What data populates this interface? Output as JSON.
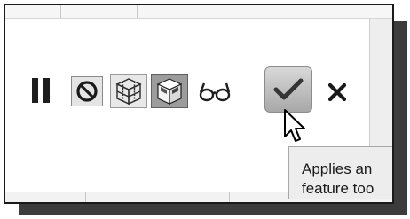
{
  "toolbar": {
    "tools": [
      {
        "name": "pause",
        "icon": "pause-icon"
      },
      {
        "name": "no-geometry",
        "icon": "prohibited-icon"
      },
      {
        "name": "geometry-preview",
        "icon": "wireframe-box-icon"
      },
      {
        "name": "attached-geometry",
        "icon": "shaded-box-icon"
      },
      {
        "name": "verify",
        "icon": "glasses-icon"
      },
      {
        "name": "apply",
        "icon": "checkmark-icon"
      },
      {
        "name": "cancel",
        "icon": "close-icon"
      }
    ]
  },
  "tooltip": {
    "line1": "Applies an",
    "line2": "feature too"
  },
  "colors": {
    "apply_bg": "#bdbdbd",
    "selected_tool_bg": "#9c9c9c",
    "tooltip_bg": "#ededed"
  }
}
